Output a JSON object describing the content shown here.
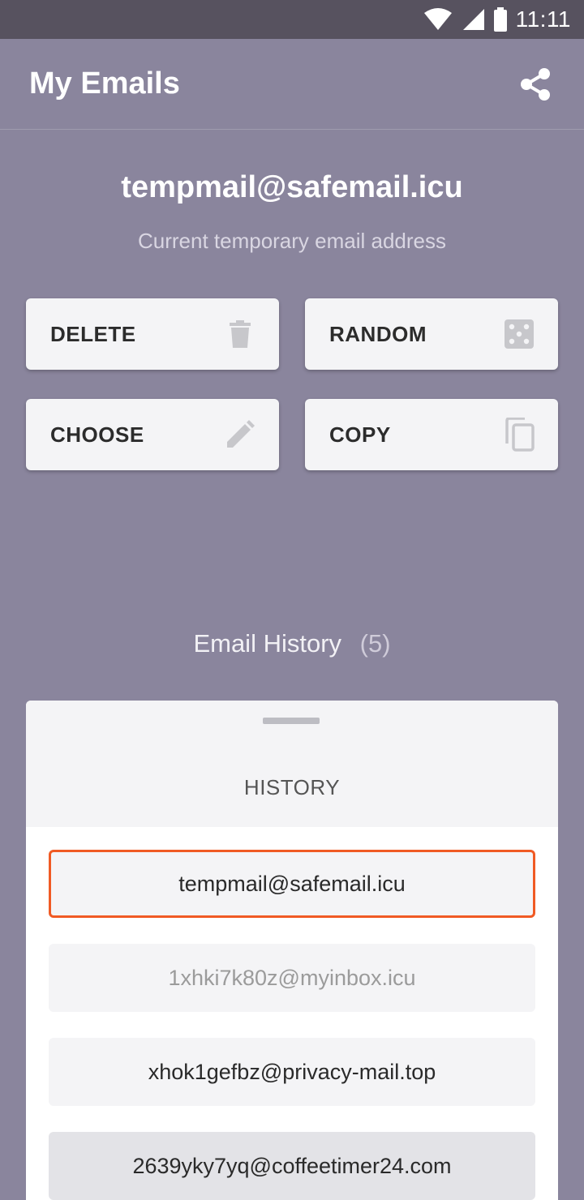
{
  "status_bar": {
    "time": "11:11"
  },
  "app_bar": {
    "title": "My Emails",
    "share_icon": "share-icon"
  },
  "current": {
    "email": "tempmail@safemail.icu",
    "caption": "Current temporary email address"
  },
  "actions": {
    "delete": {
      "label": "DELETE",
      "icon": "trash-icon"
    },
    "random": {
      "label": "RANDOM",
      "icon": "dice-icon"
    },
    "choose": {
      "label": "CHOOSE",
      "icon": "pencil-icon"
    },
    "copy": {
      "label": "COPY",
      "icon": "copy-icon"
    }
  },
  "history": {
    "heading": "Email History",
    "count": "(5)",
    "sheet_title": "HISTORY",
    "items": [
      {
        "email": "tempmail@safemail.icu",
        "selected": true
      },
      {
        "email": "1xhki7k80z@myinbox.icu"
      },
      {
        "email": "xhok1gefbz@privacy-mail.top"
      },
      {
        "email": "2639yky7yq@coffeetimer24.com"
      }
    ]
  },
  "colors": {
    "background": "#8a859d",
    "status_bar": "#57525f",
    "selected_border": "#f05a24"
  }
}
